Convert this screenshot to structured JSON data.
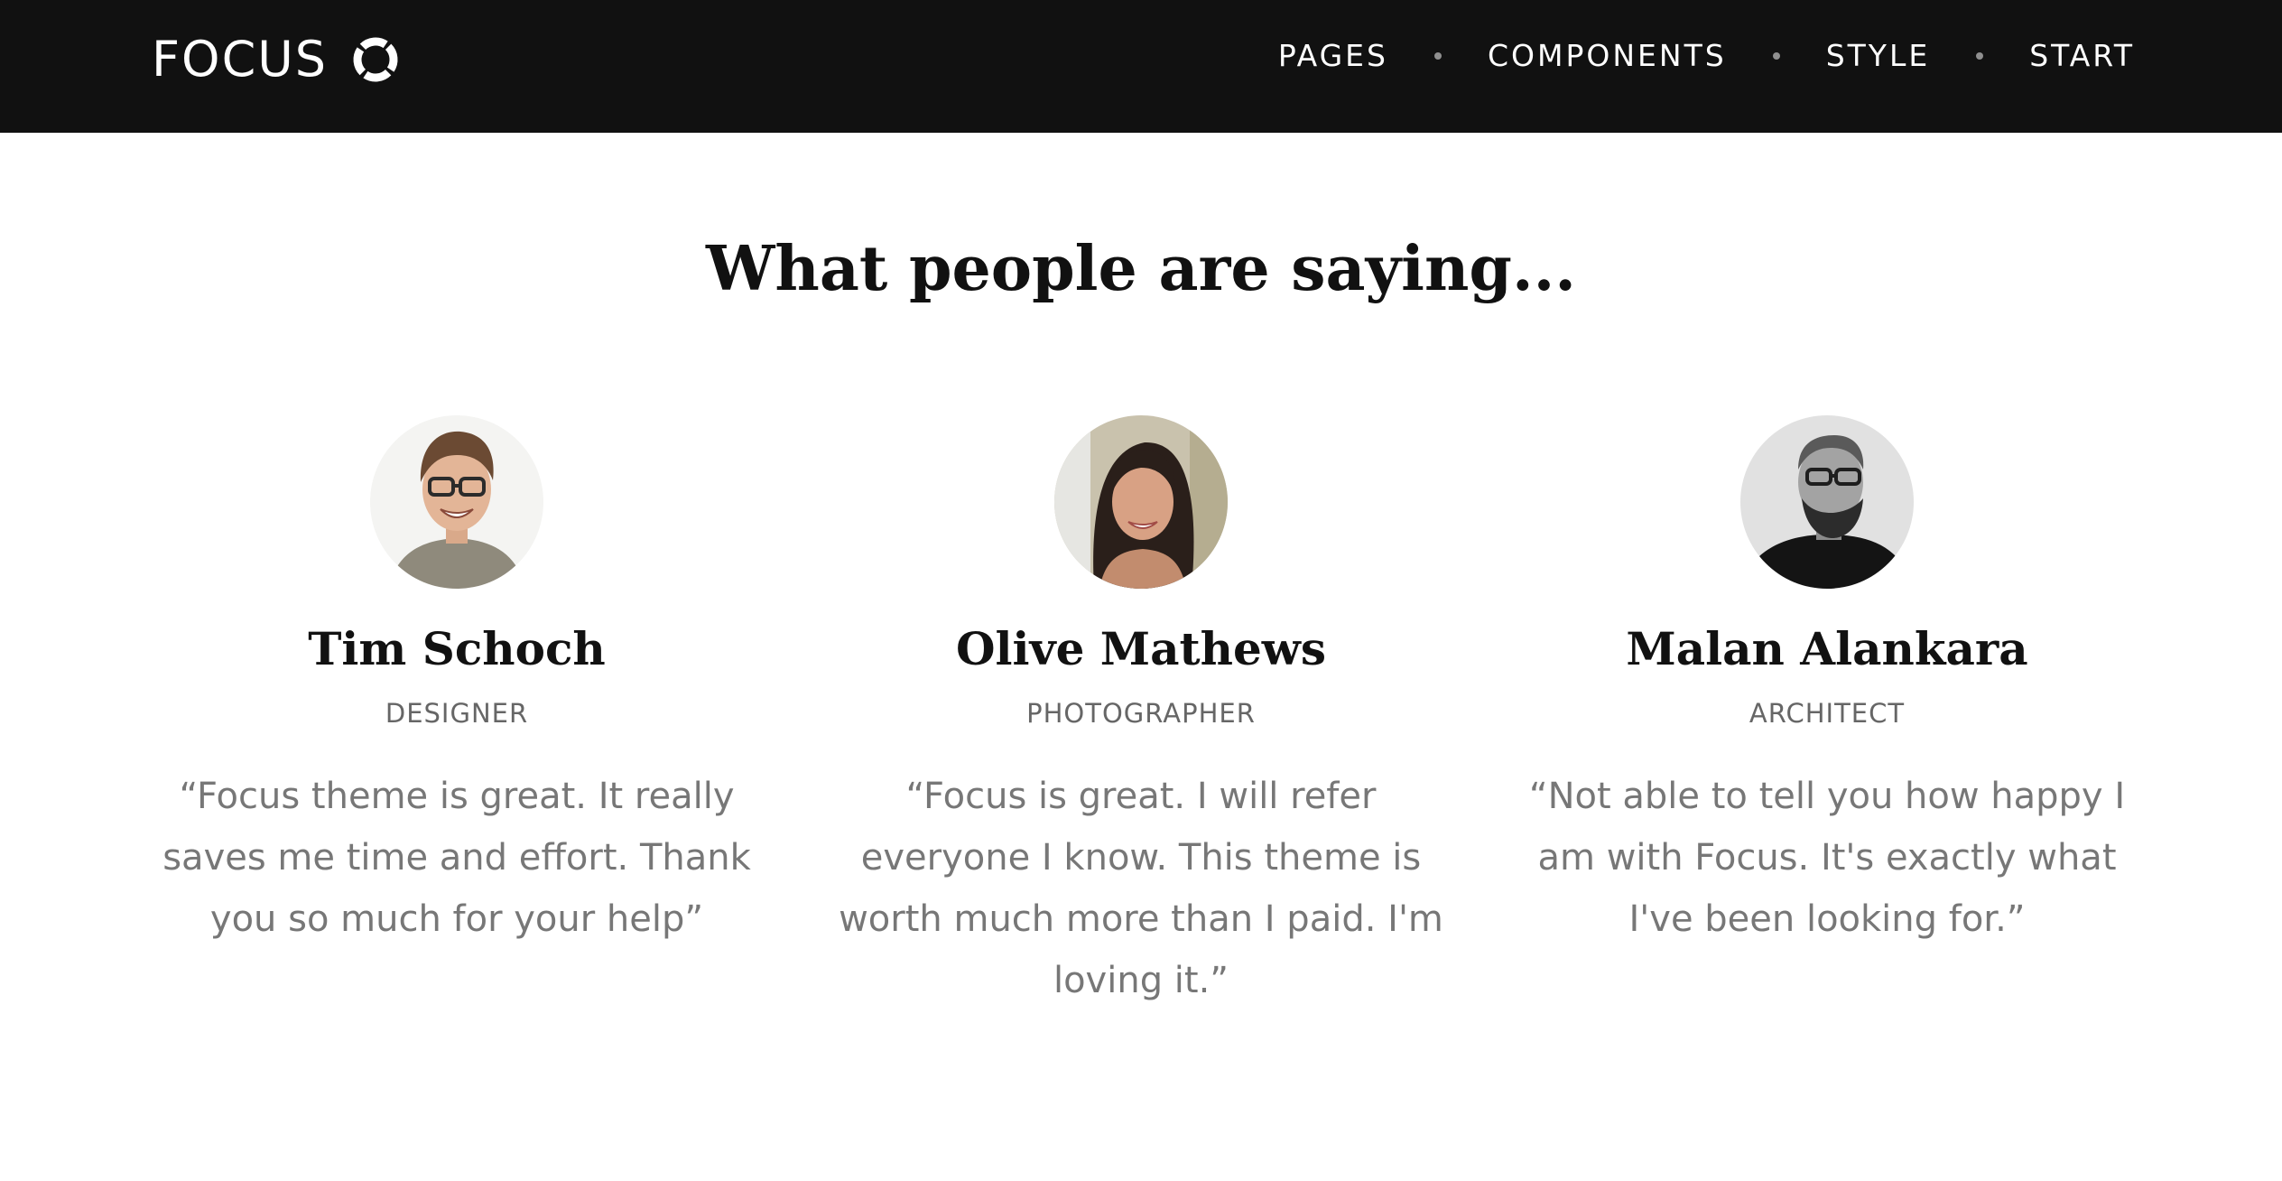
{
  "header": {
    "logo_text": "FOCUS",
    "nav": [
      {
        "label": "PAGES"
      },
      {
        "label": "COMPONENTS"
      },
      {
        "label": "STYLE"
      },
      {
        "label": "START"
      }
    ]
  },
  "testimonials": {
    "heading": "What people are saying...",
    "items": [
      {
        "name": "Tim Schoch",
        "role": "DESIGNER",
        "quote": "“Focus theme is great. It really saves me time and effort. Thank you so much for your help”"
      },
      {
        "name": "Olive Mathews",
        "role": "PHOTOGRAPHER",
        "quote": "“Focus is great. I will refer everyone I know. This theme is worth much more than I paid. I'm loving it.”"
      },
      {
        "name": "Malan Alankara",
        "role": "ARCHITECT",
        "quote": "“Not able to tell you how happy I am with Focus. It's exactly what I've been looking for.”"
      }
    ]
  },
  "colors": {
    "navbar_bg": "#111111",
    "nav_text": "#ffffff",
    "nav_separator": "#8f8f8f",
    "heading_text": "#111111",
    "role_text": "#666666",
    "quote_text": "#777777"
  },
  "icons": {
    "logo": "ring-logo-icon",
    "separator": "dot-separator-icon"
  }
}
